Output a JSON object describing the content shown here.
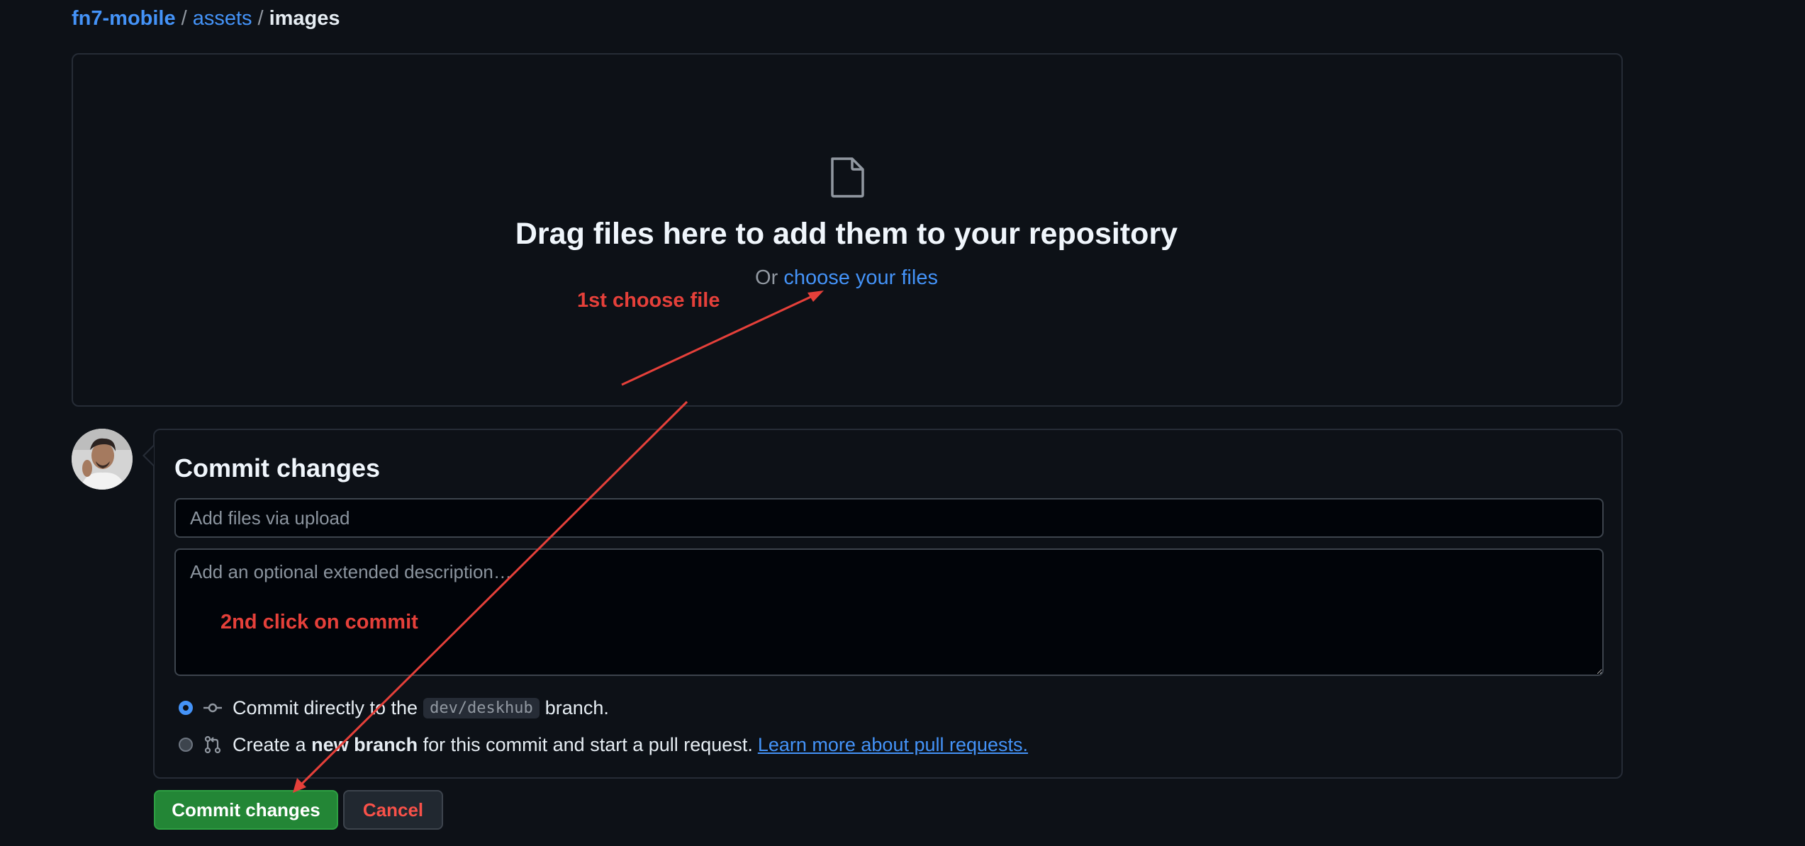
{
  "breadcrumb": {
    "repo": "fn7-mobile",
    "folder": "assets",
    "current": "images",
    "separator": "/"
  },
  "dropzone": {
    "icon": "file-icon",
    "title": "Drag files here to add them to your repository",
    "or_text": "Or",
    "choose_link": "choose your files"
  },
  "commit": {
    "title": "Commit changes",
    "summary_placeholder": "Add files via upload",
    "description_placeholder": "Add an optional extended description…",
    "option_direct": {
      "prefix": "Commit directly to the",
      "branch": "dev/deskhub",
      "suffix": "branch.",
      "selected": true
    },
    "option_new": {
      "prefix": "Create a",
      "bold": "new branch",
      "suffix": "for this commit and start a pull request.",
      "link": "Learn more about pull requests.",
      "selected": false
    }
  },
  "buttons": {
    "commit": "Commit changes",
    "cancel": "Cancel"
  },
  "annotations": {
    "step1": "1st choose file",
    "step2": "2nd click on commit",
    "color": "#e5403a"
  },
  "colors": {
    "background": "#0d1117",
    "link": "#4493f8",
    "primary_button": "#238636",
    "danger_text": "#f85149"
  }
}
